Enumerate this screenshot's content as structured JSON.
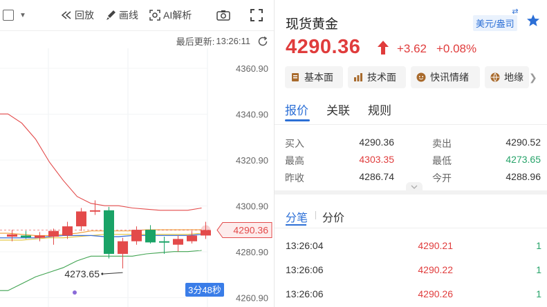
{
  "toolbar": {
    "replay_label": "回放",
    "draw_label": "画线",
    "ai_label": "AI解析"
  },
  "update": {
    "label": "最后更新:",
    "time": "13:26:11"
  },
  "chart": {
    "price_axis": [
      "4360.90",
      "4340.90",
      "4320.90",
      "4300.90",
      "4280.90",
      "4260.90"
    ],
    "current_price_tag": "4290.36",
    "low_marker": "4273.65",
    "countdown": "3分48秒"
  },
  "chart_data": {
    "type": "candlestick",
    "ylim": [
      4260.9,
      4363
    ],
    "y_ticks": [
      4360.9,
      4340.9,
      4320.9,
      4300.9,
      4280.9,
      4260.9
    ],
    "candles": [
      {
        "open": 4287.5,
        "high": 4290.5,
        "low": 4285.5,
        "close": 4288.5,
        "dir": "up"
      },
      {
        "open": 4288.0,
        "high": 4290.0,
        "low": 4286.5,
        "close": 4287.2,
        "dir": "down"
      },
      {
        "open": 4287.0,
        "high": 4289.5,
        "low": 4285.5,
        "close": 4288.0,
        "dir": "up"
      },
      {
        "open": 4287.5,
        "high": 4291.0,
        "low": 4284.0,
        "close": 4290.0,
        "dir": "up"
      },
      {
        "open": 4288.0,
        "high": 4294.0,
        "low": 4286.5,
        "close": 4292.0,
        "dir": "up"
      },
      {
        "open": 4292.0,
        "high": 4300.0,
        "low": 4290.0,
        "close": 4298.5,
        "dir": "up"
      },
      {
        "open": 4298.5,
        "high": 4303.35,
        "low": 4297.0,
        "close": 4299.0,
        "dir": "up"
      },
      {
        "open": 4299.0,
        "high": 4300.5,
        "low": 4278.0,
        "close": 4280.0,
        "dir": "down"
      },
      {
        "open": 4280.0,
        "high": 4287.0,
        "low": 4273.65,
        "close": 4285.5,
        "dir": "up"
      },
      {
        "open": 4285.5,
        "high": 4292.0,
        "low": 4284.0,
        "close": 4290.5,
        "dir": "up"
      },
      {
        "open": 4290.5,
        "high": 4292.5,
        "low": 4284.5,
        "close": 4285.0,
        "dir": "down"
      },
      {
        "open": 4285.0,
        "high": 4287.5,
        "low": 4280.0,
        "close": 4285.5,
        "dir": "down"
      },
      {
        "open": 4284.0,
        "high": 4288.0,
        "low": 4281.0,
        "close": 4286.5,
        "dir": "up"
      },
      {
        "open": 4285.5,
        "high": 4290.0,
        "low": 4284.5,
        "close": 4288.0,
        "dir": "up"
      },
      {
        "open": 4288.0,
        "high": 4294.0,
        "low": 4286.5,
        "close": 4290.36,
        "dir": "up"
      }
    ],
    "bands": {
      "upper": [
        4341,
        4337,
        4330,
        4320,
        4312,
        4305,
        4302,
        4301,
        4301,
        4300,
        4299.5,
        4299,
        4299,
        4299,
        4300
      ],
      "lower": [
        4264,
        4267,
        4270,
        4272,
        4274,
        4277,
        4279,
        4279,
        4279,
        4279,
        4280,
        4280.5,
        4281,
        4281,
        4281.5
      ],
      "ma_orange": [
        4289,
        4288.5,
        4288,
        4288,
        4288.5,
        4289,
        4290,
        4290,
        4290,
        4290,
        4290.5,
        4290.5,
        4290.5,
        4290.5,
        4290.5
      ],
      "ma_blue": [
        4287,
        4287,
        4287,
        4287.5,
        4288,
        4288,
        4288,
        4287.5,
        4287.5,
        4288,
        4288,
        4288,
        4288,
        4288,
        4288.5
      ],
      "ma_yellow": [
        4286,
        4286,
        4286.5,
        4287,
        4287,
        4287.5,
        4288,
        4288.5,
        4288.5,
        4288.5,
        4288.5,
        4288.5,
        4288.5,
        4288.5,
        4289
      ]
    },
    "colors": {
      "up": "#e34a4a",
      "down": "#1aa367",
      "upper": "#e34a4a",
      "lower": "#3fa350",
      "orange": "#f09a2e",
      "blue": "#3a6fd8",
      "yellow": "#e3c33a"
    }
  },
  "header": {
    "title": "现货黄金",
    "unit_badge": "美元/盎司",
    "price": "4290.36",
    "change": "+3.62",
    "change_pct": "+0.08%"
  },
  "chips": [
    {
      "label": "基本面",
      "icon": "document-icon"
    },
    {
      "label": "技术面",
      "icon": "bar-chart-icon"
    },
    {
      "label": "快讯情绪",
      "icon": "emotion-icon"
    },
    {
      "label": "地缘",
      "icon": "globe-icon"
    }
  ],
  "tabs": [
    "报价",
    "关联",
    "规则"
  ],
  "quote": {
    "buy_label": "买入",
    "buy": "4290.36",
    "sell_label": "卖出",
    "sell": "4290.52",
    "high_label": "最高",
    "high": "4303.35",
    "low_label": "最低",
    "low": "4273.65",
    "prev_label": "昨收",
    "prev": "4286.74",
    "open_label": "今开",
    "open": "4288.96"
  },
  "subtabs": [
    "分笔",
    "分价"
  ],
  "ticks": [
    {
      "time": "13:26:04",
      "price": "4290.21",
      "vol": "1"
    },
    {
      "time": "13:26:06",
      "price": "4290.22",
      "vol": "1"
    },
    {
      "time": "13:26:06",
      "price": "4290.26",
      "vol": "1"
    }
  ],
  "colors": {
    "accent": "#2c6fd6",
    "up": "#e03c3c",
    "down": "#26a369"
  }
}
